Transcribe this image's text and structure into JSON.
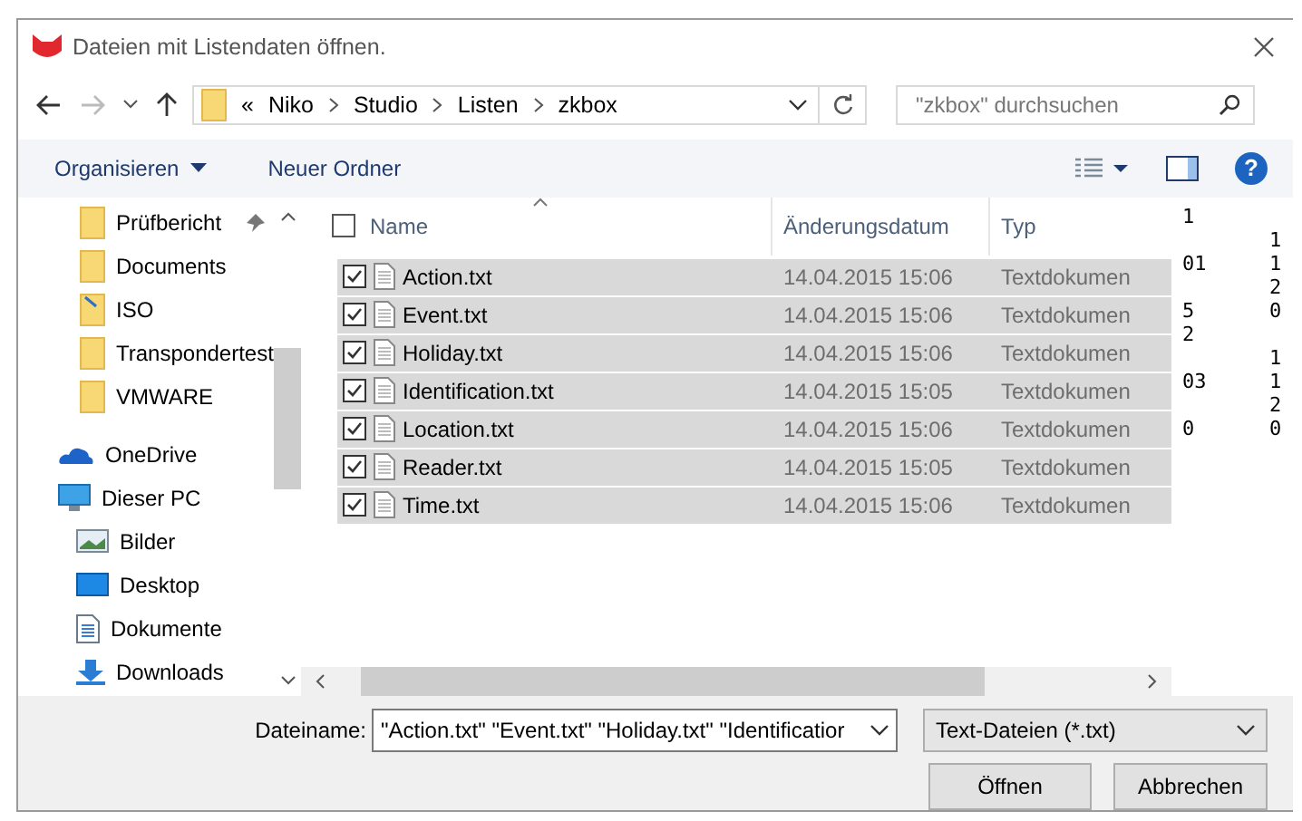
{
  "window": {
    "title": "Dateien mit Listendaten öffnen."
  },
  "address_bar": {
    "overflow": "«",
    "crumbs": [
      "Niko",
      "Studio",
      "Listen",
      "zkbox"
    ],
    "search": {
      "placeholder": "\"zkbox\" durchsuchen"
    },
    "forward_disabled": true
  },
  "toolbar": {
    "organize": "Organisieren",
    "new_folder": "Neuer Ordner",
    "help": "?"
  },
  "sidebar": {
    "quick_access": [
      {
        "label": "Prüfbericht",
        "kind": "folder",
        "pinned": true
      },
      {
        "label": "Documents",
        "kind": "folder",
        "pinned": false
      },
      {
        "label": "ISO",
        "kind": "link-folder",
        "pinned": false
      },
      {
        "label": "Transpondertest",
        "kind": "folder",
        "pinned": false
      },
      {
        "label": "VMWARE",
        "kind": "folder",
        "pinned": false
      }
    ],
    "items": [
      {
        "label": "OneDrive",
        "kind": "cloud"
      },
      {
        "label": "Dieser PC",
        "kind": "pc",
        "children": [
          {
            "label": "Bilder",
            "kind": "pictures"
          },
          {
            "label": "Desktop",
            "kind": "desktop"
          },
          {
            "label": "Dokumente",
            "kind": "documents"
          },
          {
            "label": "Downloads",
            "kind": "downloads"
          }
        ]
      }
    ]
  },
  "file_list": {
    "columns": [
      "Name",
      "Änderungsdatum",
      "Typ"
    ],
    "select_all_checked": false,
    "rows": [
      {
        "name": "Action.txt",
        "modified": "14.04.2015 15:06",
        "type": "Textdokumen",
        "checked": true,
        "selected": true
      },
      {
        "name": "Event.txt",
        "modified": "14.04.2015 15:06",
        "type": "Textdokumen",
        "checked": true,
        "selected": true
      },
      {
        "name": "Holiday.txt",
        "modified": "14.04.2015 15:06",
        "type": "Textdokumen",
        "checked": true,
        "selected": true
      },
      {
        "name": "Identification.txt",
        "modified": "14.04.2015 15:05",
        "type": "Textdokumen",
        "checked": true,
        "selected": true
      },
      {
        "name": "Location.txt",
        "modified": "14.04.2015 15:06",
        "type": "Textdokumen",
        "checked": true,
        "selected": true
      },
      {
        "name": "Reader.txt",
        "modified": "14.04.2015 15:05",
        "type": "Textdokumen",
        "checked": true,
        "selected": true
      },
      {
        "name": "Time.txt",
        "modified": "14.04.2015 15:06",
        "type": "Textdokumen",
        "checked": true,
        "selected": true
      }
    ]
  },
  "stray_glyphs": [
    {
      "column_1": "1"
    },
    {
      "column_2": "1"
    },
    {
      "column_1": "01",
      "column_2": "1"
    },
    {
      "column_2": "2"
    },
    {
      "column_1": "5",
      "column_2": "0"
    },
    {
      "column_1": "2"
    },
    {
      "column_2": "1"
    },
    {
      "column_1": "03",
      "column_2": "1"
    },
    {
      "column_2": "2"
    },
    {
      "column_1": "0",
      "column_2": "0"
    }
  ],
  "footer": {
    "filename_label": "Dateiname:",
    "filename_value": "\"Action.txt\" \"Event.txt\" \"Holiday.txt\" \"Identificatior",
    "filter": "Text-Dateien (*.txt)",
    "buttons": [
      "Öffnen",
      "Abbrechen"
    ]
  }
}
